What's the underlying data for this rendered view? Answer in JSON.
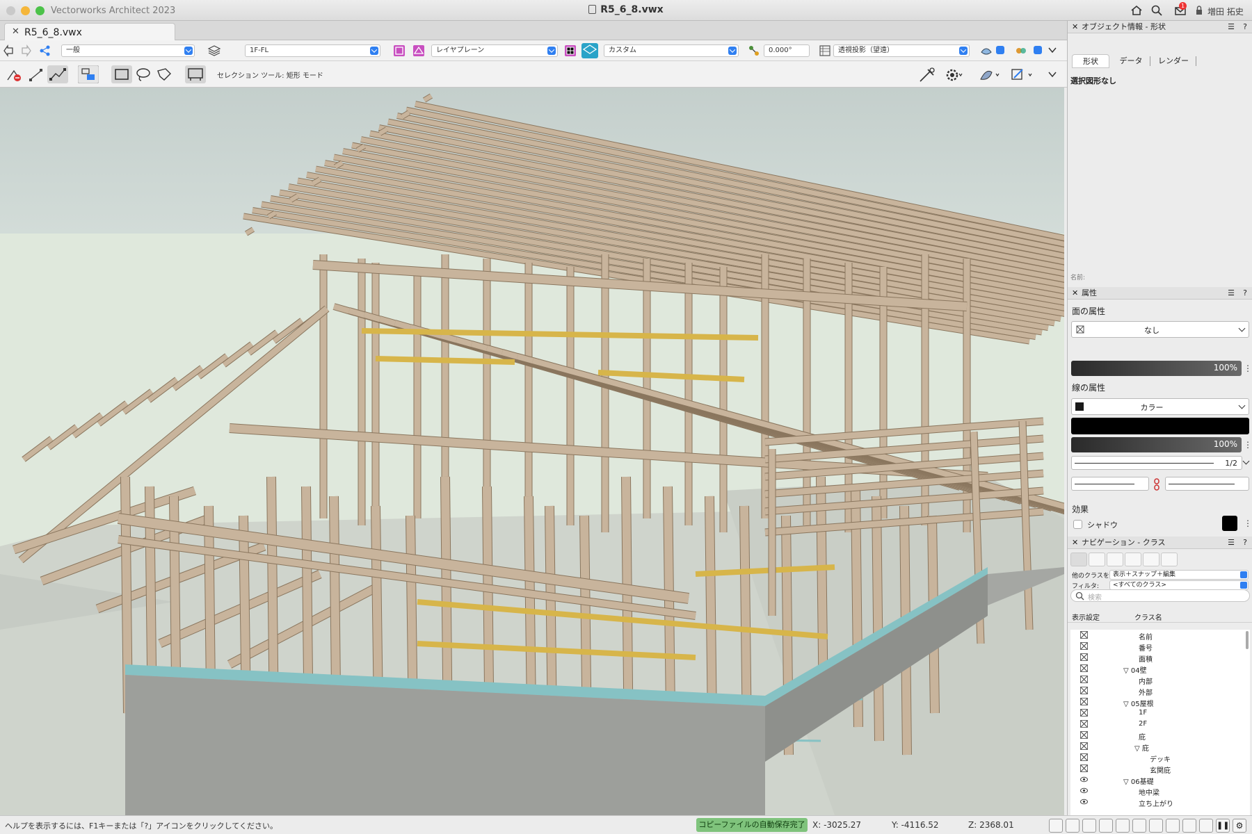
{
  "window": {
    "app_name": "Vectorworks Architect 2023",
    "doc_title": "R5_6_8.vwx",
    "user_name": "増田 拓史",
    "notification_count": "1"
  },
  "tabs": [
    {
      "label": "R5_6_8.vwx"
    }
  ],
  "view_bar": {
    "class_value": "一般",
    "layer_value": "1F-FL",
    "plane_value": "レイヤプレーン",
    "view_value": "カスタム",
    "angle_value": "0.000°",
    "projection_value": "透視投影（望遠）"
  },
  "mode_bar": {
    "label": "セレクション ツール: 矩形 モード"
  },
  "object_info": {
    "title": "オブジェクト情報 - 形状",
    "tabs": [
      "形状",
      "データ",
      "レンダー"
    ],
    "no_selection": "選択図形なし",
    "name_label": "名前:"
  },
  "attributes": {
    "title": "属性",
    "fill_section": "面の属性",
    "fill_value": "なし",
    "fill_opacity": "100%",
    "line_section": "線の属性",
    "line_value": "カラー",
    "line_opacity": "100%",
    "line_weight": "1/2",
    "effects_section": "効果",
    "shadow_label": "シャドウ"
  },
  "navigation": {
    "title": "ナビゲーション - クラス",
    "other_classes_label": "他のクラスを:",
    "other_classes_value": "表示＋スナップ＋編集",
    "filter_label": "フィルタ:",
    "filter_value": "<すべてのクラス>",
    "search_placeholder": "検索",
    "col_visibility": "表示設定",
    "col_class_name": "クラス名",
    "rows": [
      {
        "name": "名前",
        "level": 3,
        "vis": "hidden"
      },
      {
        "name": "番号",
        "level": 3,
        "vis": "hidden"
      },
      {
        "name": "面積",
        "level": 3,
        "vis": "hidden"
      },
      {
        "name": "▽ 04壁",
        "level": 1,
        "vis": "hidden"
      },
      {
        "name": "内部",
        "level": 3,
        "vis": "hidden"
      },
      {
        "name": "外部",
        "level": 3,
        "vis": "hidden"
      },
      {
        "name": "▽ 05屋根",
        "level": 1,
        "vis": "hidden"
      },
      {
        "name": "1F",
        "level": 3,
        "vis": "hidden"
      },
      {
        "name": "2F",
        "level": 3,
        "vis": "hidden"
      },
      {
        "name": "庇",
        "level": 3,
        "vis": "hidden"
      },
      {
        "name": "▽ 庇",
        "level": 2,
        "vis": "hidden"
      },
      {
        "name": "デッキ",
        "level": 4,
        "vis": "hidden"
      },
      {
        "name": "玄関庇",
        "level": 4,
        "vis": "hidden"
      },
      {
        "name": "▽ 06基礎",
        "level": 1,
        "vis": "visible"
      },
      {
        "name": "地中梁",
        "level": 3,
        "vis": "visible"
      },
      {
        "name": "立ち上がり",
        "level": 3,
        "vis": "visible"
      }
    ]
  },
  "status_bar": {
    "help_text": "ヘルプを表示するには、F1キーまたは「?」アイコンをクリックしてください。",
    "autosave": "コピーファイルの自動保存完了",
    "x": "X: -3025.27",
    "y": "Y: -4116.52",
    "z": "Z: 2368.01"
  },
  "colors": {
    "timber": "#c8b49c",
    "timber_dark": "#8a765e",
    "concrete": "#a9aaa6",
    "sill": "#86c2c4",
    "beam_yellow": "#d7b54a",
    "accent_blue": "#2f7ff1",
    "autosave_green": "#7fc37c"
  }
}
